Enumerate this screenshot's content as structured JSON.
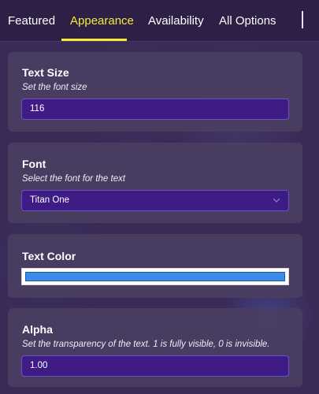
{
  "tabs": [
    {
      "label": "Featured",
      "active": false
    },
    {
      "label": "Appearance",
      "active": true
    },
    {
      "label": "Availability",
      "active": false
    },
    {
      "label": "All Options",
      "active": false
    }
  ],
  "settings": {
    "text_size": {
      "title": "Text Size",
      "description": "Set the font size",
      "value": "116"
    },
    "font": {
      "title": "Font",
      "description": "Select the font for the text",
      "value": "Titan One"
    },
    "text_color": {
      "title": "Text Color",
      "value_color": "#3b8bea"
    },
    "alpha": {
      "title": "Alpha",
      "description": "Set the transparency of the text. 1 is fully visible, 0 is invisible.",
      "value": "1.00"
    }
  },
  "colors": {
    "active_tab": "#f5ea3a",
    "field_background": "#3e1b85",
    "card_background": "#4a3e62"
  }
}
